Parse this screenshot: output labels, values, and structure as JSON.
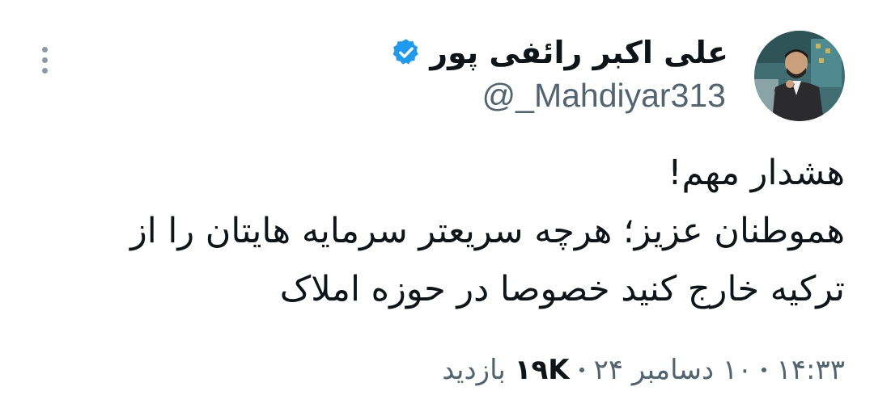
{
  "author": {
    "display_name": "علی اکبر رائفی پور",
    "handle": "@_Mahdiyar313",
    "verified": true,
    "avatar_icon": "profile-photo"
  },
  "tweet": {
    "lines": [
      "هشدار مهم!",
      "هموطنان عزیز؛ هرچه سریعتر سرمایه هایتان را از",
      "ترکیه خارج کنید خصوصا در حوزه املاک"
    ]
  },
  "meta": {
    "time": "۱۴:۳۳",
    "date": "۱۰ دسامبر ۲۴",
    "views_count": "۱۹K",
    "views_label": "بازدید"
  },
  "colors": {
    "verified": "#1d9bf0",
    "text": "#0f1419",
    "secondary": "#536471"
  },
  "icons": {
    "more": "more-vertical-icon",
    "verified": "verified-badge-icon"
  }
}
